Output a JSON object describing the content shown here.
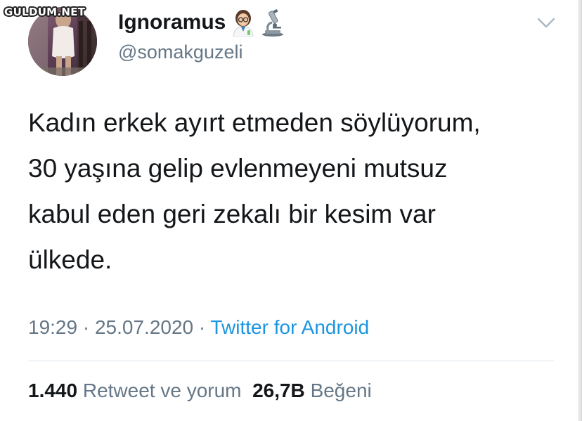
{
  "watermark": "GULDUM.NET",
  "user": {
    "display_name": "Ignoramus",
    "handle": "@somakguzeli",
    "name_emojis": [
      "woman-scientist-icon",
      "microscope-icon"
    ]
  },
  "tweet": {
    "lines": [
      "Kadın erkek ayırt etmeden söylüyorum,",
      "30 yaşına gelip evlenmeyeni mutsuz",
      "kabul eden geri zekalı bir kesim var",
      "ülkede."
    ]
  },
  "meta": {
    "time": "19:29",
    "separator1": " · ",
    "date": "25.07.2020",
    "separator2": " · ",
    "source": "Twitter for Android"
  },
  "stats": {
    "retweets_count": "1.440",
    "retweets_label": "Retweet ve yorum",
    "likes_count": "26,7B",
    "likes_label": "Beğeni"
  },
  "colors": {
    "text": "#14171a",
    "secondary": "#657786",
    "link": "#1b95e0",
    "divider": "#e1e8ed"
  },
  "icons": {
    "menu": "chevron-down-icon"
  }
}
